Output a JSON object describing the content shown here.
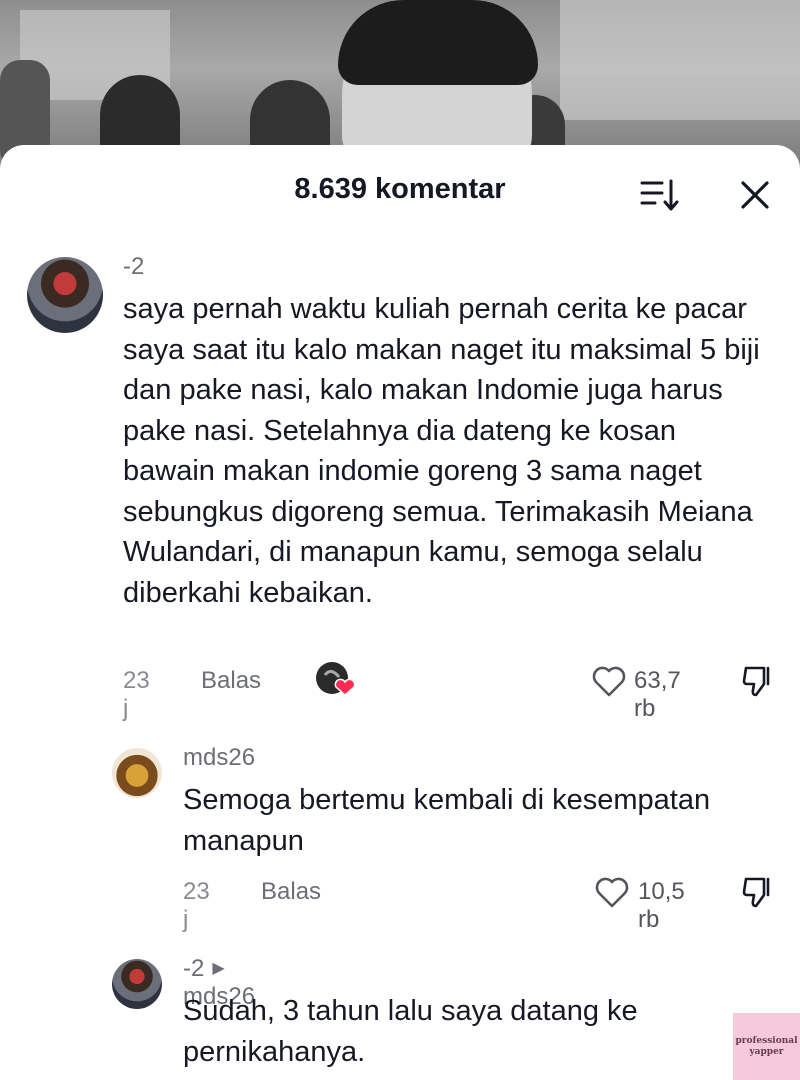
{
  "header": {
    "title": "8.639 komentar"
  },
  "comments": [
    {
      "username": "-2",
      "text": "saya pernah waktu kuliah pernah cerita ke pacar saya saat itu kalo makan naget itu maksimal 5 biji dan pake nasi, kalo makan Indomie juga harus pake nasi. Setelahnya dia dateng ke kosan bawain makan indomie goreng 3 sama naget sebungkus digoreng semua. Terimakasih Meiana Wulandari, di manapun kamu, semoga selalu diberkahi kebaikan.",
      "time": "23 j",
      "reply_label": "Balas",
      "likes": "63,7 rb"
    },
    {
      "username": "mds26",
      "text": "Semoga bertemu kembali di kesempatan manapun",
      "time": "23 j",
      "reply_label": "Balas",
      "likes": "10,5 rb"
    },
    {
      "username": "-2",
      "reply_to": "mds26",
      "text": "Sudah, 3 tahun lalu saya datang ke pernikahanya."
    }
  ],
  "watermark": {
    "line1": "professional",
    "line2": "yapper"
  },
  "icons": {
    "sort": "sort-icon",
    "close": "close-icon",
    "like": "heart-outline-icon",
    "dislike": "thumbs-down-icon",
    "creator_like": "creator-liked-heart-icon"
  },
  "colors": {
    "text": "#161823",
    "muted": "#8a8b91",
    "creator_heart": "#fe2c55",
    "watermark_bg": "#f7c9dc"
  }
}
